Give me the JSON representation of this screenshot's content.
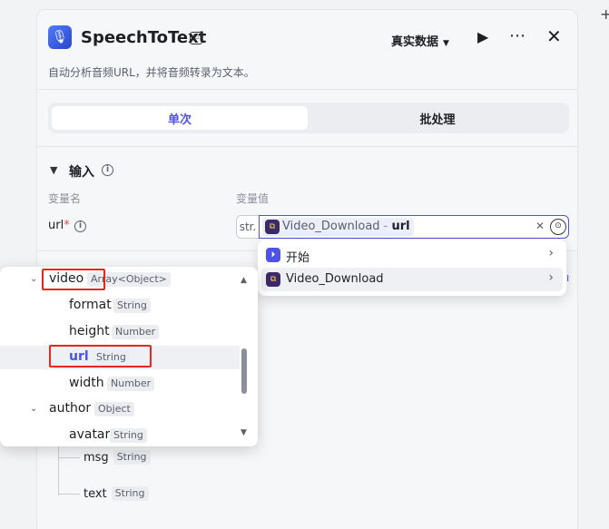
{
  "header": {
    "title": "SpeechToText",
    "title_badge": "⎚",
    "mode_label": "真实数据",
    "description": "自动分析音频URL，并将音频转录为文本。"
  },
  "tabs": [
    {
      "label": "单次",
      "active": true
    },
    {
      "label": "批处理",
      "active": false
    }
  ],
  "inputs": {
    "section_title": "输入",
    "col_name": "变量名",
    "col_value": "变量值",
    "param": {
      "name": "url",
      "required_mark": "*",
      "type_short": "str.",
      "ref_node": "Video_Download",
      "ref_sep": " - ",
      "ref_field": "url"
    }
  },
  "dropdown": {
    "items": [
      {
        "label": "开始",
        "icon": "start-icon"
      },
      {
        "label": "Video_Download",
        "icon": "plugin-icon",
        "hover": true
      }
    ]
  },
  "subpanel": {
    "rows": [
      {
        "name": "video",
        "type": "Array<Object>",
        "level": 0,
        "expandable": true
      },
      {
        "name": "format",
        "type": "String",
        "level": 1
      },
      {
        "name": "height",
        "type": "Number",
        "level": 1
      },
      {
        "name": "url",
        "type": "String",
        "level": 1,
        "selected": true
      },
      {
        "name": "width",
        "type": "Number",
        "level": 1
      },
      {
        "name": "author",
        "type": "Object",
        "level": 0,
        "expandable": true
      },
      {
        "name": "avatar",
        "type": "String",
        "level": 1
      }
    ]
  },
  "background_outputs": [
    {
      "name": "msg",
      "type": "String"
    },
    {
      "name": "text",
      "type": "String"
    }
  ],
  "colors": {
    "accent": "#4d53e8",
    "highlight_box": "#e5271f",
    "required": "#e5484d"
  }
}
